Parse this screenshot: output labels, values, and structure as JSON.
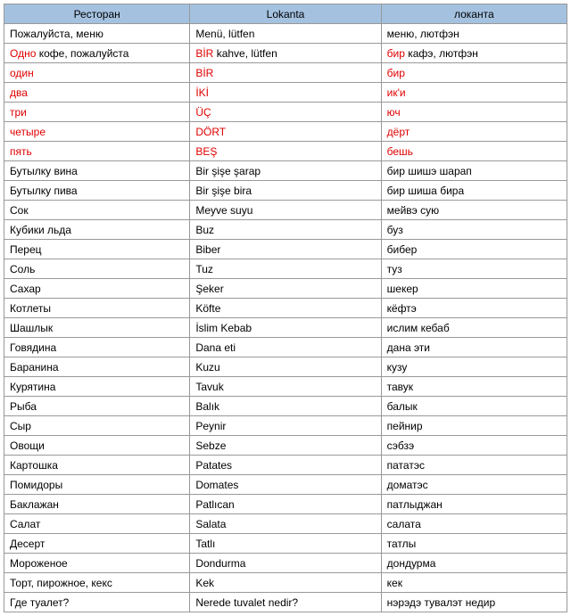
{
  "headers": {
    "a": "Ресторан",
    "b": "Lokanta",
    "c": "локанта"
  },
  "rows": [
    {
      "a": [
        [
          "",
          " Пожалуйста, меню"
        ]
      ],
      "b": [
        [
          "",
          "Menü, lütfen"
        ]
      ],
      "c": [
        [
          "",
          "меню, лютфэн"
        ]
      ]
    },
    {
      "a": [
        [
          "red",
          "Одно"
        ],
        [
          "",
          " кофе, пожалуйста"
        ]
      ],
      "b": [
        [
          "red",
          "BİR"
        ],
        [
          "",
          " kahve, lütfen"
        ]
      ],
      "c": [
        [
          "red",
          "бир"
        ],
        [
          "",
          " кафэ, лютфэн"
        ]
      ]
    },
    {
      "a": [
        [
          "red",
          "один"
        ]
      ],
      "b": [
        [
          "red",
          "BİR"
        ]
      ],
      "c": [
        [
          "red",
          "бир"
        ]
      ]
    },
    {
      "a": [
        [
          "red",
          "два"
        ]
      ],
      "b": [
        [
          "red",
          "İKİ"
        ]
      ],
      "c": [
        [
          "red",
          "ик'и"
        ]
      ]
    },
    {
      "a": [
        [
          "red",
          "три"
        ]
      ],
      "b": [
        [
          "red",
          "ÜÇ"
        ]
      ],
      "c": [
        [
          "red",
          "юч"
        ]
      ]
    },
    {
      "a": [
        [
          "red",
          "четыре"
        ]
      ],
      "b": [
        [
          "red",
          "DÖRT"
        ]
      ],
      "c": [
        [
          "red",
          "дёрт"
        ]
      ]
    },
    {
      "a": [
        [
          "red",
          "пять"
        ]
      ],
      "b": [
        [
          "red",
          "BEŞ"
        ]
      ],
      "c": [
        [
          "red",
          "бешь"
        ]
      ]
    },
    {
      "a": [
        [
          "",
          "Бутылку вина"
        ]
      ],
      "b": [
        [
          "",
          "Bir şişe şarap"
        ]
      ],
      "c": [
        [
          "",
          "бир шишэ шарап"
        ]
      ]
    },
    {
      "a": [
        [
          "",
          "Бутылку пива"
        ]
      ],
      "b": [
        [
          "",
          "Bir şişe bira"
        ]
      ],
      "c": [
        [
          "",
          "бир шиша бира"
        ]
      ]
    },
    {
      "a": [
        [
          "",
          "Сок"
        ]
      ],
      "b": [
        [
          "",
          "Meyve suyu"
        ]
      ],
      "c": [
        [
          "",
          "мейвэ сую"
        ]
      ]
    },
    {
      "a": [
        [
          "",
          "Кубики льда"
        ]
      ],
      "b": [
        [
          "",
          "Buz"
        ]
      ],
      "c": [
        [
          "",
          "буз"
        ]
      ]
    },
    {
      "a": [
        [
          "",
          "Перец"
        ]
      ],
      "b": [
        [
          "",
          "Biber"
        ]
      ],
      "c": [
        [
          "",
          "бибер"
        ]
      ]
    },
    {
      "a": [
        [
          "",
          "Соль"
        ]
      ],
      "b": [
        [
          "",
          "Tuz"
        ]
      ],
      "c": [
        [
          "",
          "туз"
        ]
      ]
    },
    {
      "a": [
        [
          "",
          "Сахар"
        ]
      ],
      "b": [
        [
          "",
          "Şeker"
        ]
      ],
      "c": [
        [
          "",
          "шекер"
        ]
      ]
    },
    {
      "a": [
        [
          "",
          "Котлеты"
        ]
      ],
      "b": [
        [
          "",
          "Köfte"
        ]
      ],
      "c": [
        [
          "",
          "кёфтэ"
        ]
      ]
    },
    {
      "a": [
        [
          "",
          "Шашлык"
        ]
      ],
      "b": [
        [
          "",
          "İslim Kebab"
        ]
      ],
      "c": [
        [
          "",
          "ислим кебаб"
        ]
      ]
    },
    {
      "a": [
        [
          "",
          "Говядина"
        ]
      ],
      "b": [
        [
          "",
          "Dana eti"
        ]
      ],
      "c": [
        [
          "",
          "дана эти"
        ]
      ]
    },
    {
      "a": [
        [
          "",
          "Баранина"
        ]
      ],
      "b": [
        [
          "",
          "Kuzu"
        ]
      ],
      "c": [
        [
          "",
          "кузу"
        ]
      ]
    },
    {
      "a": [
        [
          "",
          "Курятина"
        ]
      ],
      "b": [
        [
          "",
          "Tavuk"
        ]
      ],
      "c": [
        [
          "",
          "тавук"
        ]
      ]
    },
    {
      "a": [
        [
          "",
          "Рыба"
        ]
      ],
      "b": [
        [
          "",
          "Balık"
        ]
      ],
      "c": [
        [
          "",
          "балык"
        ]
      ]
    },
    {
      "a": [
        [
          "",
          "Сыр"
        ]
      ],
      "b": [
        [
          "",
          "Peynir"
        ]
      ],
      "c": [
        [
          "",
          "пейнир"
        ]
      ]
    },
    {
      "a": [
        [
          "",
          "Овощи"
        ]
      ],
      "b": [
        [
          "",
          "Sebze"
        ]
      ],
      "c": [
        [
          "",
          "сэбзэ"
        ]
      ]
    },
    {
      "a": [
        [
          "",
          "Картошка"
        ]
      ],
      "b": [
        [
          "",
          "Patates"
        ]
      ],
      "c": [
        [
          "",
          "пататэс"
        ]
      ]
    },
    {
      "a": [
        [
          "",
          "Помидоры"
        ]
      ],
      "b": [
        [
          "",
          "Domates"
        ]
      ],
      "c": [
        [
          "",
          "доматэс"
        ]
      ]
    },
    {
      "a": [
        [
          "",
          "Баклажан"
        ]
      ],
      "b": [
        [
          "",
          "Patlıcan"
        ]
      ],
      "c": [
        [
          "",
          "патлыджан"
        ]
      ]
    },
    {
      "a": [
        [
          "",
          "Салат"
        ]
      ],
      "b": [
        [
          "",
          "Salata"
        ]
      ],
      "c": [
        [
          "",
          "салата"
        ]
      ]
    },
    {
      "a": [
        [
          "",
          "Десерт"
        ]
      ],
      "b": [
        [
          "",
          "Tatlı"
        ]
      ],
      "c": [
        [
          "",
          "татлы"
        ]
      ]
    },
    {
      "a": [
        [
          "",
          "Мороженое"
        ]
      ],
      "b": [
        [
          "",
          "Dondurma"
        ]
      ],
      "c": [
        [
          "",
          "дондурма"
        ]
      ]
    },
    {
      "a": [
        [
          "",
          "Торт, пирожное, кекс"
        ]
      ],
      "b": [
        [
          "",
          "Kek"
        ]
      ],
      "c": [
        [
          "",
          "кек"
        ]
      ]
    },
    {
      "a": [
        [
          "",
          "Где туалет?"
        ]
      ],
      "b": [
        [
          "",
          "Nerede tuvalet nedir?"
        ]
      ],
      "c": [
        [
          "",
          "нэрэдэ тувалэт недир"
        ]
      ]
    }
  ]
}
